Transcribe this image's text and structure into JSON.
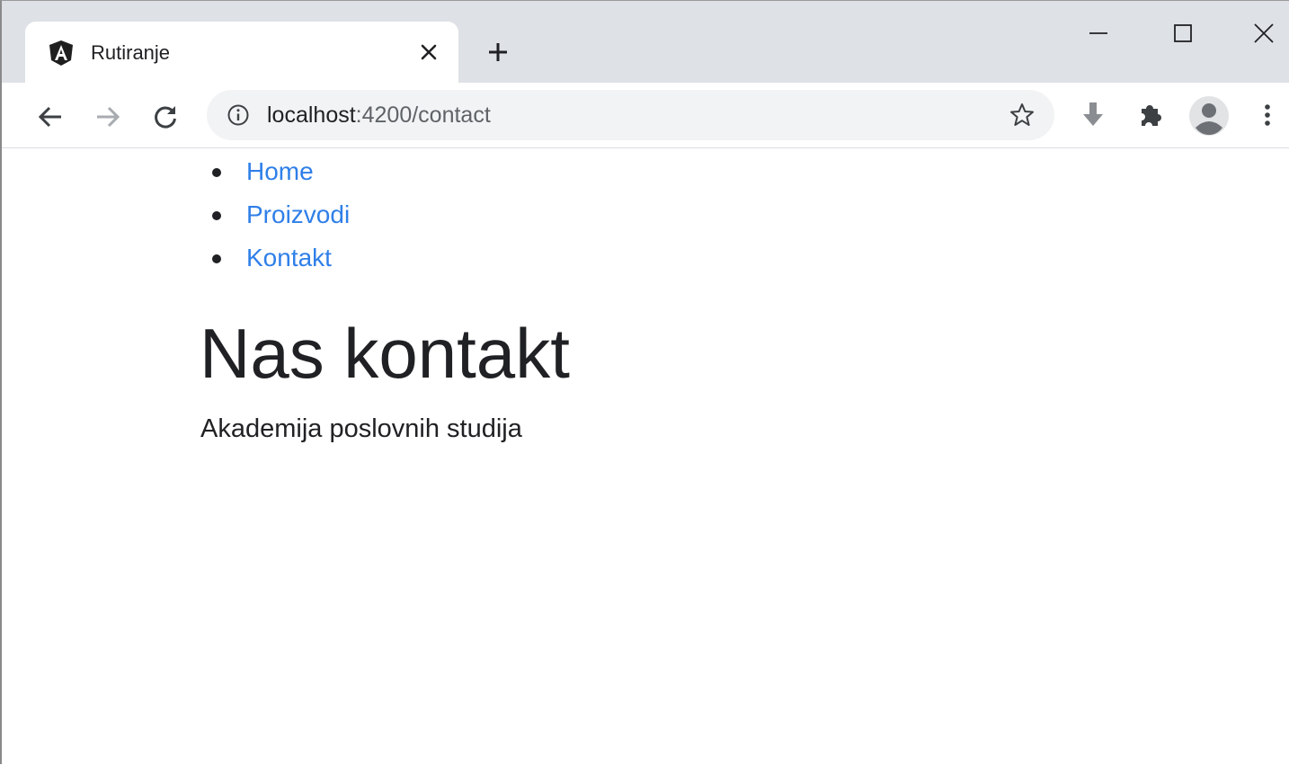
{
  "browser": {
    "tab": {
      "title": "Rutiranje",
      "favicon": "angular-logo-icon"
    },
    "address_bar": {
      "host": "localhost",
      "rest": ":4200/contact"
    }
  },
  "page": {
    "nav": [
      "Home",
      "Proizvodi",
      "Kontakt"
    ],
    "heading": "Nas kontakt",
    "text": "Akademija poslovnih studija"
  },
  "colors": {
    "tabstrip": "#dee1e6",
    "omnibox": "#f1f3f4",
    "link": "#2f7fe8",
    "text": "#202124"
  }
}
